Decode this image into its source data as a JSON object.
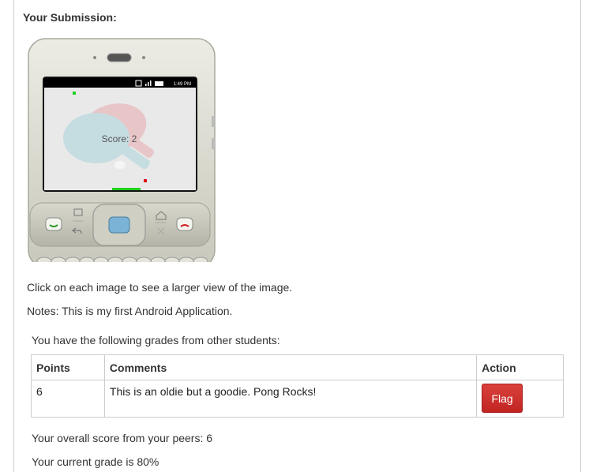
{
  "submission": {
    "heading": "Your Submission:",
    "image": {
      "status_time": "1:49 PM",
      "status_icons": "G",
      "game_score": "Score: 2"
    },
    "click_note": "Click on each image to see a larger view of the image.",
    "notes": "Notes: This is my first Android Application."
  },
  "grades": {
    "intro": "You have the following grades from other students:",
    "columns": [
      "Points",
      "Comments",
      "Action"
    ],
    "rows": [
      {
        "points": "6",
        "comment": "This is an oldie but a goodie. Pong Rocks!",
        "action_label": "Flag"
      }
    ],
    "flag_color": "#c9302c"
  },
  "summary": {
    "peer_score": "Your overall score from your peers: 6",
    "current_grade": "Your current grade is 80%"
  }
}
